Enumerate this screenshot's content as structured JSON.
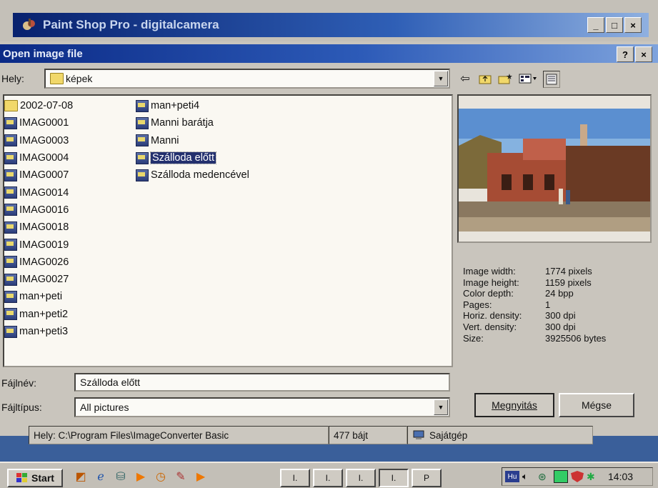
{
  "app": {
    "title": "Paint Shop Pro - digitalcamera"
  },
  "window_buttons": {
    "minimize": "_",
    "maximize": "□",
    "close": "×"
  },
  "dialog": {
    "title": "Open image file",
    "help": "?",
    "close": "×",
    "location_label": "Hely:",
    "location_value": "képek",
    "filename_label": "Fájlnév:",
    "filename_value": "Szálloda előtt",
    "filetype_label": "Fájltípus:",
    "filetype_value": "All pictures",
    "open_button": "Megnyitás",
    "cancel_button": "Mégse"
  },
  "toolbar_icons": [
    "back-arrow-icon",
    "up-folder-icon",
    "new-folder-icon",
    "view-menu-icon",
    "details-icon"
  ],
  "files_col1": [
    {
      "name": "2002-07-08",
      "type": "folder"
    },
    {
      "name": "IMAG0001",
      "type": "image"
    },
    {
      "name": "IMAG0003",
      "type": "image"
    },
    {
      "name": "IMAG0004",
      "type": "image"
    },
    {
      "name": "IMAG0007",
      "type": "image"
    },
    {
      "name": "IMAG0014",
      "type": "image"
    },
    {
      "name": "IMAG0016",
      "type": "image"
    },
    {
      "name": "IMAG0018",
      "type": "image"
    },
    {
      "name": "IMAG0019",
      "type": "image"
    },
    {
      "name": "IMAG0026",
      "type": "image"
    },
    {
      "name": "IMAG0027",
      "type": "image"
    },
    {
      "name": "man+peti",
      "type": "image"
    },
    {
      "name": "man+peti2",
      "type": "image"
    },
    {
      "name": "man+peti3",
      "type": "image"
    }
  ],
  "files_col2": [
    {
      "name": "man+peti4",
      "type": "image"
    },
    {
      "name": "Manni barátja",
      "type": "image"
    },
    {
      "name": "Manni",
      "type": "image"
    },
    {
      "name": "Szálloda előtt",
      "type": "image",
      "selected": true
    },
    {
      "name": "Szálloda medencével",
      "type": "image"
    }
  ],
  "image_info": [
    {
      "k": "Image width:",
      "v": "1774 pixels"
    },
    {
      "k": "Image height:",
      "v": "1159 pixels"
    },
    {
      "k": "Color depth:",
      "v": "24 bpp"
    },
    {
      "k": "Pages:",
      "v": "1"
    },
    {
      "k": "Horiz. density:",
      "v": "300 dpi"
    },
    {
      "k": "Vert. density:",
      "v": "300 dpi"
    },
    {
      "k": "Size:",
      "v": "3925506 bytes"
    }
  ],
  "statusbar": {
    "path": "Hely: C:\\Program Files\\ImageConverter Basic",
    "size": "477 bájt",
    "location": "Sajátgép"
  },
  "taskbar": {
    "start": "Start",
    "clock": "14:03",
    "lang": "Hu",
    "tasks": [
      "I.",
      "I.",
      "I.",
      "I.",
      "P"
    ]
  },
  "colors": {
    "titlebar_active": "#0b2a86",
    "selection": "#23306e",
    "desktop": "#3a5f9a"
  }
}
